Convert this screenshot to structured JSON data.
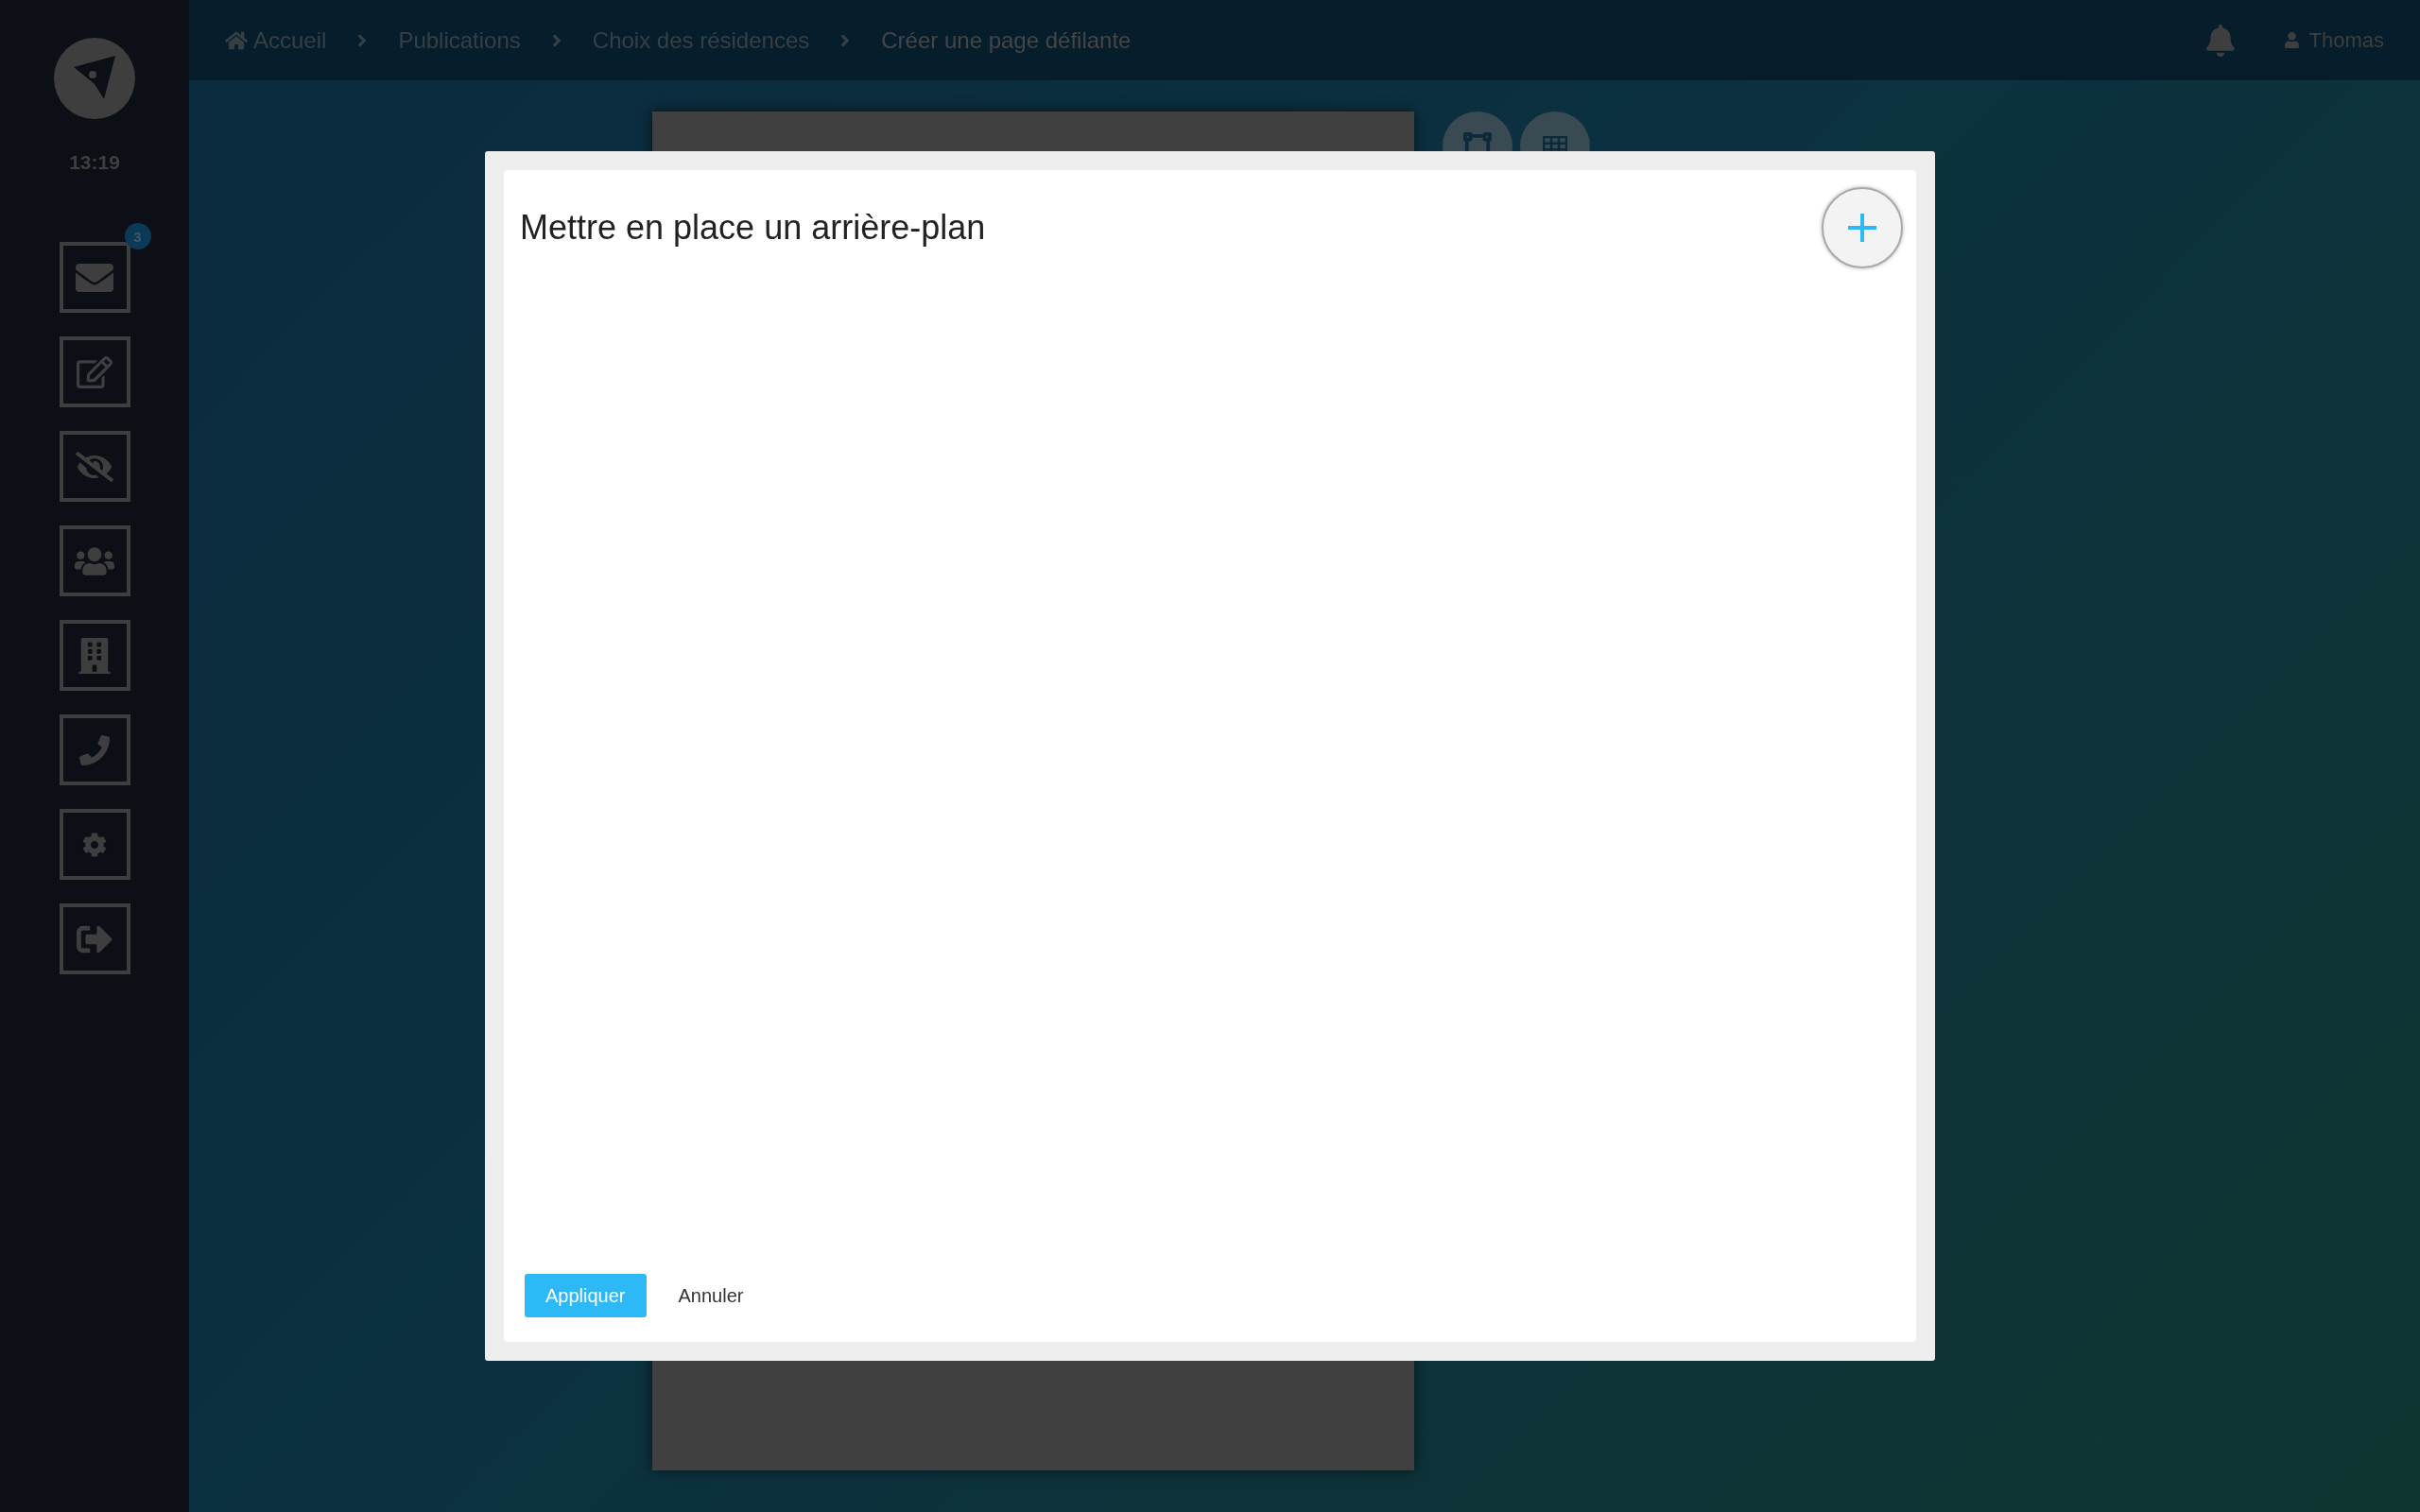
{
  "sidebar": {
    "time": "13:19",
    "items": [
      {
        "kind": "mail",
        "badge": "3"
      },
      {
        "kind": "edit"
      },
      {
        "kind": "hidden"
      },
      {
        "kind": "users"
      },
      {
        "kind": "building"
      },
      {
        "kind": "phone"
      },
      {
        "kind": "settings"
      },
      {
        "kind": "logout"
      }
    ]
  },
  "breadcrumbs": [
    {
      "label": "Accueil",
      "home": true,
      "current": false
    },
    {
      "label": "Publications",
      "home": false,
      "current": false
    },
    {
      "label": "Choix des résidences",
      "home": false,
      "current": false
    },
    {
      "label": "Créer une page défilante",
      "home": false,
      "current": true
    }
  ],
  "user": {
    "name": "Thomas"
  },
  "dialog": {
    "title": "Mettre en place un arrière-plan",
    "buttons": [
      {
        "label": "Appliquer",
        "kind": "primary"
      },
      {
        "label": "Annuler",
        "kind": "text"
      }
    ]
  }
}
